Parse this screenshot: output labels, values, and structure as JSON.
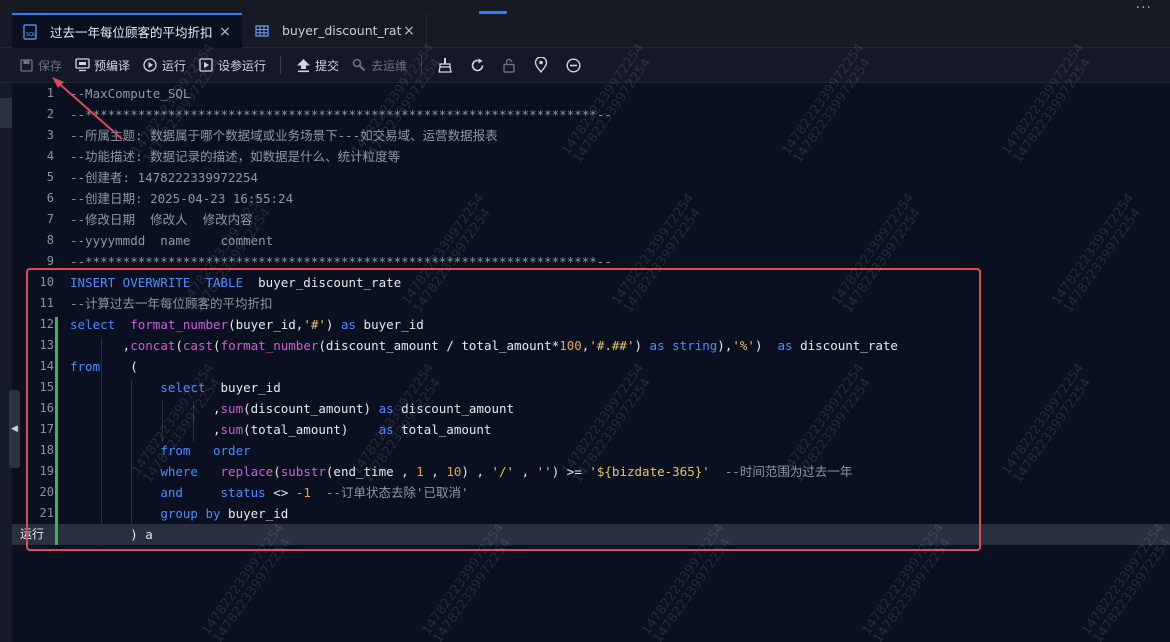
{
  "tabs": [
    {
      "label": "过去一年每位顾客的平均折扣",
      "active": true,
      "icon": "sql-file-icon"
    },
    {
      "label": "buyer_discount_rate",
      "active": false,
      "icon": "table-icon"
    }
  ],
  "toolbar": {
    "save": "保存",
    "precompile": "预编译",
    "run": "运行",
    "run_with_params": "设参运行",
    "submit": "提交",
    "devops": "去运维"
  },
  "editor": {
    "status_label": "运行",
    "lines": [
      {
        "n": "1",
        "tokens": [
          [
            "cm",
            "--MaxCompute_SQL"
          ]
        ]
      },
      {
        "n": "2",
        "tokens": [
          [
            "cm",
            "--********************************************************************--"
          ]
        ]
      },
      {
        "n": "3",
        "tokens": [
          [
            "cm",
            "--所属主题: 数据属于哪个数据域或业务场景下---如交易域、运营数据报表"
          ]
        ]
      },
      {
        "n": "4",
        "tokens": [
          [
            "cm",
            "--功能描述: 数据记录的描述，如数据是什么、统计粒度等"
          ]
        ]
      },
      {
        "n": "5",
        "tokens": [
          [
            "cm",
            "--创建者: 1478222339972254"
          ]
        ]
      },
      {
        "n": "6",
        "tokens": [
          [
            "cm",
            "--创建日期: 2025-04-23 16:55:24"
          ]
        ]
      },
      {
        "n": "7",
        "tokens": [
          [
            "cm",
            "--修改日期  修改人  修改内容"
          ]
        ]
      },
      {
        "n": "8",
        "tokens": [
          [
            "cm",
            "--yyyymmdd  name    comment"
          ]
        ]
      },
      {
        "n": "9",
        "tokens": [
          [
            "cm",
            "--********************************************************************--"
          ]
        ]
      },
      {
        "n": "10",
        "tokens": [
          [
            "kw",
            "INSERT OVERWRITE  TABLE  "
          ],
          [
            "id",
            "buyer_discount_rate"
          ]
        ]
      },
      {
        "n": "11",
        "tokens": [
          [
            "cm",
            "--计算过去一年每位顾客的平均折扣"
          ]
        ]
      },
      {
        "n": "12",
        "tokens": [
          [
            "kw",
            "select  "
          ],
          [
            "fn",
            "format_number"
          ],
          [
            "id",
            "(buyer_id,"
          ],
          [
            "str",
            "'#'"
          ],
          [
            "id",
            ") "
          ],
          [
            "kw",
            "as"
          ],
          [
            "id",
            " buyer_id"
          ]
        ]
      },
      {
        "n": "13",
        "tokens": [
          [
            "id",
            "       ,"
          ],
          [
            "fn",
            "concat"
          ],
          [
            "id",
            "("
          ],
          [
            "fn",
            "cast"
          ],
          [
            "id",
            "("
          ],
          [
            "fn",
            "format_number"
          ],
          [
            "id",
            "(discount_amount / total_amount*"
          ],
          [
            "num",
            "100"
          ],
          [
            "id",
            ","
          ],
          [
            "str",
            "'#.##'"
          ],
          [
            "id",
            ") "
          ],
          [
            "kw",
            "as"
          ],
          [
            "id",
            " "
          ],
          [
            "kw",
            "string"
          ],
          [
            "id",
            "),"
          ],
          [
            "str",
            "'%'"
          ],
          [
            "id",
            ")  "
          ],
          [
            "kw",
            "as"
          ],
          [
            "id",
            " discount_rate"
          ]
        ]
      },
      {
        "n": "14",
        "tokens": [
          [
            "kw",
            "from"
          ],
          [
            "id",
            "    ("
          ]
        ]
      },
      {
        "n": "15",
        "tokens": [
          [
            "id",
            "            "
          ],
          [
            "kw",
            "select"
          ],
          [
            "id",
            "  buyer_id"
          ]
        ]
      },
      {
        "n": "16",
        "tokens": [
          [
            "id",
            "                   ,"
          ],
          [
            "fn",
            "sum"
          ],
          [
            "id",
            "(discount_amount) "
          ],
          [
            "kw",
            "as"
          ],
          [
            "id",
            " discount_amount"
          ]
        ]
      },
      {
        "n": "17",
        "tokens": [
          [
            "id",
            "                   ,"
          ],
          [
            "fn",
            "sum"
          ],
          [
            "id",
            "(total_amount)    "
          ],
          [
            "kw",
            "as"
          ],
          [
            "id",
            " total_amount"
          ]
        ]
      },
      {
        "n": "18",
        "tokens": [
          [
            "id",
            "            "
          ],
          [
            "kw",
            "from"
          ],
          [
            "id",
            "   "
          ],
          [
            "kw",
            "order"
          ]
        ]
      },
      {
        "n": "19",
        "tokens": [
          [
            "id",
            "            "
          ],
          [
            "kw",
            "where"
          ],
          [
            "id",
            "   "
          ],
          [
            "fn",
            "replace"
          ],
          [
            "id",
            "("
          ],
          [
            "fn",
            "substr"
          ],
          [
            "id",
            "(end_time , "
          ],
          [
            "num",
            "1"
          ],
          [
            "id",
            " , "
          ],
          [
            "num",
            "10"
          ],
          [
            "id",
            ") , "
          ],
          [
            "str",
            "'/'"
          ],
          [
            "id",
            " , "
          ],
          [
            "str",
            "''"
          ],
          [
            "id",
            ") >= "
          ],
          [
            "str",
            "'${bizdate-365}'"
          ],
          [
            "id",
            "  "
          ],
          [
            "cm",
            "--时间范围为过去一年"
          ]
        ]
      },
      {
        "n": "20",
        "tokens": [
          [
            "id",
            "            "
          ],
          [
            "kw",
            "and"
          ],
          [
            "id",
            "     "
          ],
          [
            "kw",
            "status"
          ],
          [
            "id",
            " <> "
          ],
          [
            "num",
            "-1"
          ],
          [
            "id",
            "  "
          ],
          [
            "cm",
            "--订单状态去除'已取消'"
          ]
        ]
      },
      {
        "n": "21",
        "tokens": [
          [
            "id",
            "            "
          ],
          [
            "kw",
            "group by"
          ],
          [
            "id",
            " buyer_id"
          ]
        ]
      },
      {
        "n": "",
        "tokens": [
          [
            "id",
            "        ) a"
          ]
        ],
        "current": true
      }
    ]
  },
  "watermark": {
    "text_a": "1478222339972254",
    "text_b": "147822339972254"
  }
}
